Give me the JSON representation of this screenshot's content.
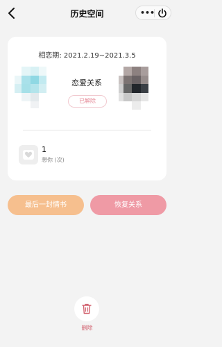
{
  "nav": {
    "title": "历史空间",
    "more_label": "•••"
  },
  "card": {
    "dates_label": "相恋期",
    "dates_value": "2021.2.19~2021.3.5",
    "relationship_title": "恋爱关系",
    "status": "已解除",
    "stat_value": "1",
    "stat_label": "想你 (次)"
  },
  "actions": {
    "last_letter": "最后一封情书",
    "restore": "恢复关系"
  },
  "footer": {
    "delete_label": "删除"
  },
  "colors": {
    "background": "#f3f3f3",
    "letter_button": "#f6bf8e",
    "restore_button": "#ef9aa5",
    "status_text": "#e58a97",
    "delete_text": "#d2626f"
  },
  "icons": {
    "back": "back-arrow-icon",
    "more": "more-dots-icon",
    "power": "power-icon",
    "stat": "heart-icon",
    "delete": "trash-icon"
  }
}
